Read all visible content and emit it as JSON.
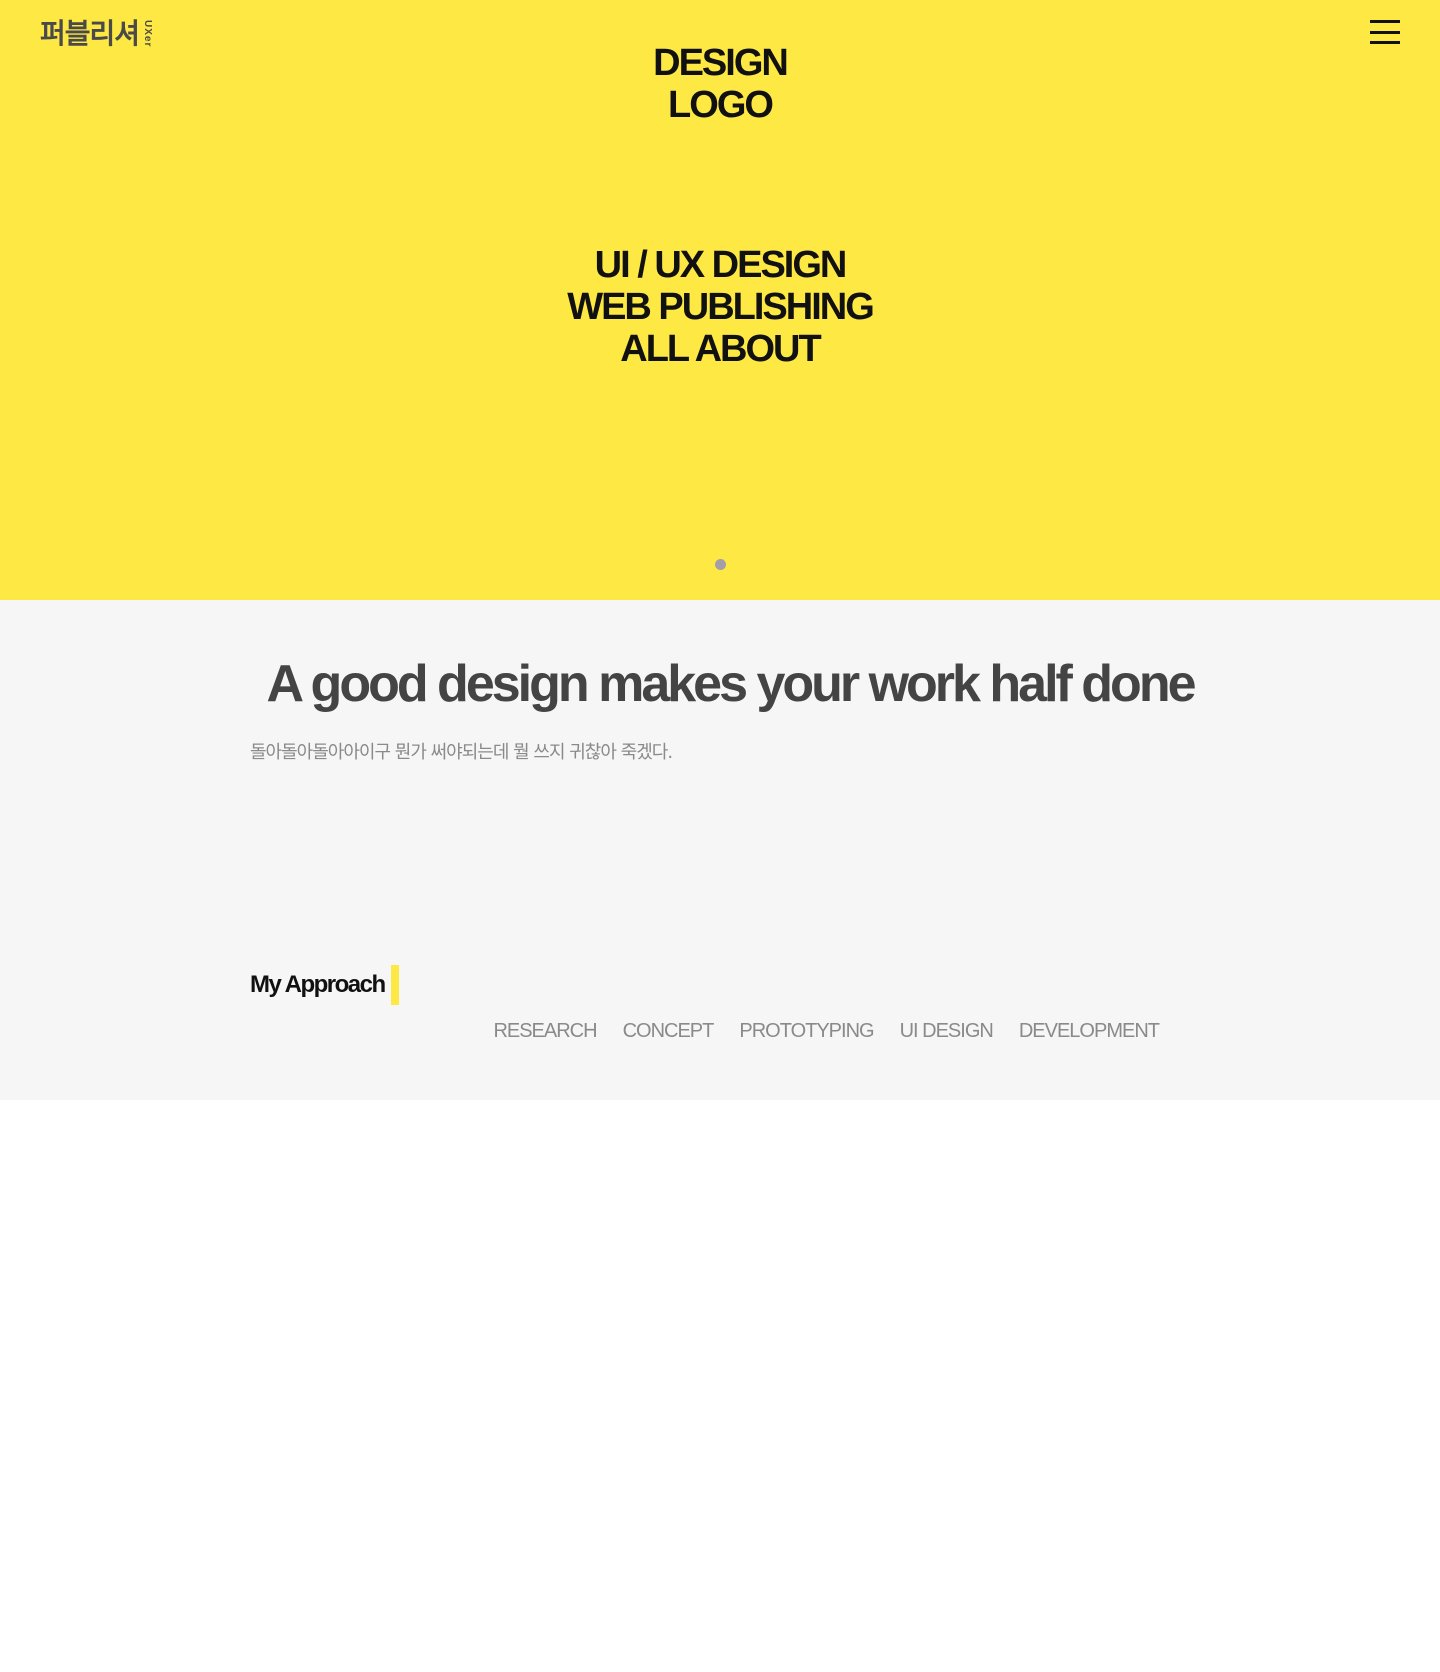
{
  "header": {
    "logo_main": "퍼블리셔",
    "logo_sub": "UXer",
    "menu_icon": "hamburger-icon"
  },
  "hero": {
    "logo_lines": [
      "DESIGN",
      "LOGO"
    ],
    "copy_lines": [
      "UI / UX DESIGN",
      "WEB PUBLISHING",
      "ALL ABOUT"
    ],
    "background": "#fee843",
    "pager_dot_color": "#a39fa8"
  },
  "about": {
    "title": "A good design makes your work half done",
    "description": "돌아돌아돌아아이구 뭔가 써야되는데 뭘 쓰지 귀찮아 죽겠다.",
    "background": "#f6f6f6"
  },
  "approach": {
    "title": "My Approach",
    "accent": "#fee843",
    "steps": [
      "RESEARCH",
      "CONCEPT",
      "PROTOTYPING",
      "UI DESIGN",
      "DEVELOPMENT"
    ]
  }
}
